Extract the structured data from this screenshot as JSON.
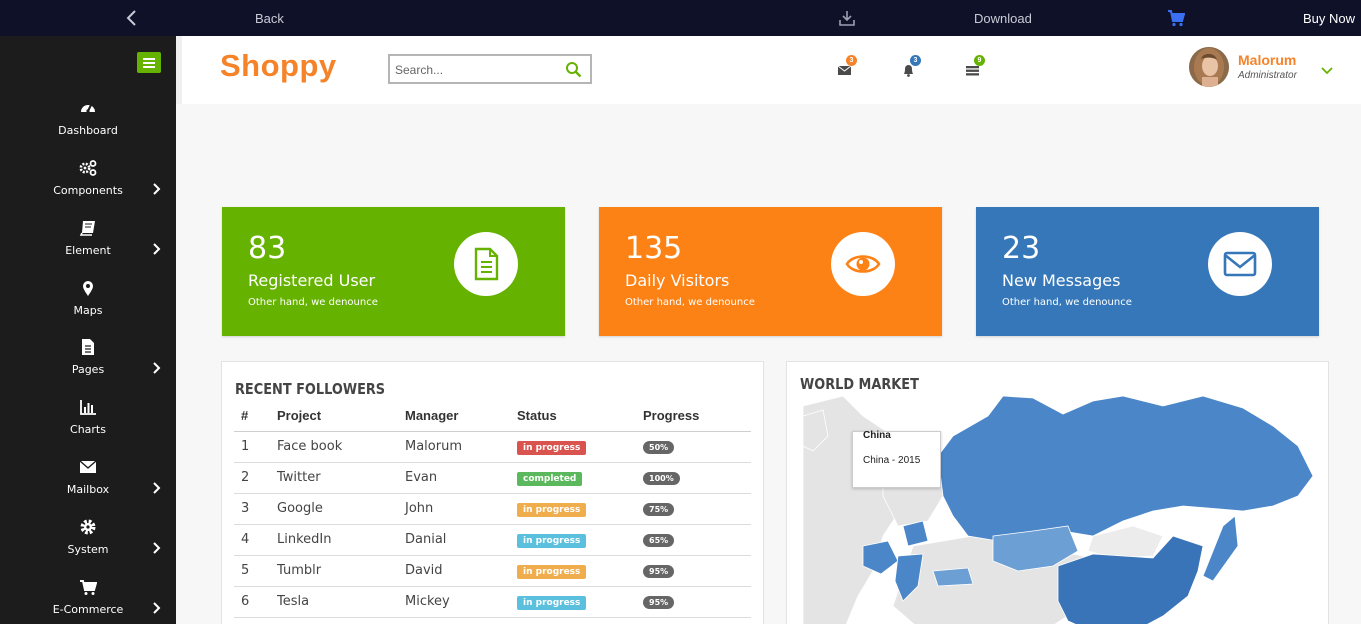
{
  "topbar": {
    "back_label": "Back",
    "download_label": "Download",
    "buy_label": "Buy Now"
  },
  "sidebar": {
    "items": [
      {
        "label": "Dashboard",
        "icon": "dashboard-icon",
        "has_submenu": false
      },
      {
        "label": "Components",
        "icon": "cogs-icon",
        "has_submenu": true
      },
      {
        "label": "Element",
        "icon": "book-icon",
        "has_submenu": true
      },
      {
        "label": "Maps",
        "icon": "map-marker-icon",
        "has_submenu": false
      },
      {
        "label": "Pages",
        "icon": "file-icon",
        "has_submenu": true
      },
      {
        "label": "Charts",
        "icon": "bar-chart-icon",
        "has_submenu": false
      },
      {
        "label": "Mailbox",
        "icon": "envelope-icon",
        "has_submenu": true
      },
      {
        "label": "System",
        "icon": "gear-icon",
        "has_submenu": true
      },
      {
        "label": "E-Commerce",
        "icon": "cart-icon",
        "has_submenu": true
      }
    ]
  },
  "header": {
    "logo": "Shoppy",
    "search_placeholder": "Search...",
    "badges": {
      "messages": "3",
      "notifications": "3",
      "tasks": "9"
    },
    "user": {
      "name": "Malorum",
      "role": "Administrator"
    }
  },
  "cards": [
    {
      "value": "83",
      "title": "Registered User",
      "subtitle": "Other hand, we denounce",
      "icon": "document-icon",
      "color": "#65b300"
    },
    {
      "value": "135",
      "title": "Daily Visitors",
      "subtitle": "Other hand, we denounce",
      "icon": "eye-icon",
      "color": "#fd8216"
    },
    {
      "value": "23",
      "title": "New Messages",
      "subtitle": "Other hand, we denounce",
      "icon": "envelope-icon",
      "color": "#3577b8"
    }
  ],
  "followers": {
    "title": "RECENT FOLLOWERS",
    "columns": [
      "#",
      "Project",
      "Manager",
      "Status",
      "Progress"
    ],
    "rows": [
      {
        "n": "1",
        "project": "Face book",
        "manager": "Malorum",
        "status": "in progress",
        "status_color": "#d9534f",
        "progress": "50%"
      },
      {
        "n": "2",
        "project": "Twitter",
        "manager": "Evan",
        "status": "completed",
        "status_color": "#5cb85c",
        "progress": "100%"
      },
      {
        "n": "3",
        "project": "Google",
        "manager": "John",
        "status": "in progress",
        "status_color": "#f0ad4e",
        "progress": "75%"
      },
      {
        "n": "4",
        "project": "LinkedIn",
        "manager": "Danial",
        "status": "in progress",
        "status_color": "#5bc0de",
        "progress": "65%"
      },
      {
        "n": "5",
        "project": "Tumblr",
        "manager": "David",
        "status": "in progress",
        "status_color": "#f0ad4e",
        "progress": "95%"
      },
      {
        "n": "6",
        "project": "Tesla",
        "manager": "Mickey",
        "status": "in progress",
        "status_color": "#5bc0de",
        "progress": "95%"
      }
    ]
  },
  "world_market": {
    "title": "WORLD MARKET",
    "tooltip_title": "China",
    "tooltip_body": "China - 2015"
  },
  "colors": {
    "accent_orange": "#f5832a",
    "accent_green": "#65b300",
    "sidebar_bg": "#1c1c1c",
    "topbar_bg": "#0f1129",
    "map_blue": "#4a86c8"
  }
}
